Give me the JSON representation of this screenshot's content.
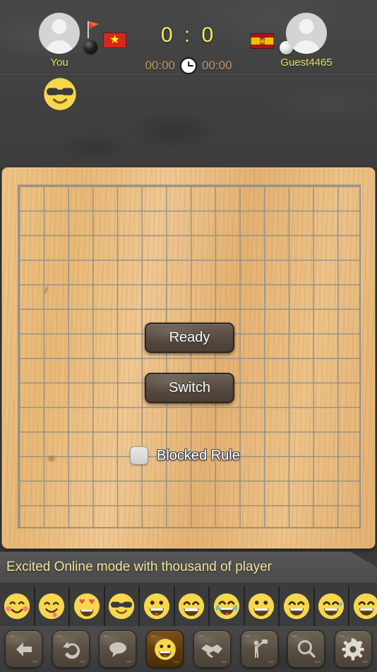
{
  "header": {
    "left_player": {
      "name": "You",
      "stone": "black-stone",
      "country_flag": "vietnam-flag",
      "turn_indicator": "red-pennant-flag",
      "avatar": "default-person-avatar"
    },
    "right_player": {
      "name": "Guest4465",
      "stone": "white-stone",
      "country_flag": "spain-flag",
      "avatar": "default-person-avatar"
    },
    "score": {
      "left": "0",
      "separator": ":",
      "right": "0",
      "display": "0 : 0",
      "color": "#f0ef5e"
    },
    "timers": {
      "left": "00:00",
      "right": "00:00",
      "clock_icon": "clock-icon",
      "color": "#c79a6a"
    },
    "chat_bubble_emoji": "sunglasses-face-emoji"
  },
  "board": {
    "type": "gomoku-board",
    "columns": 14,
    "rows": 14,
    "wood_color": "#e8b977",
    "grid_line_color": "#8f8f8a",
    "stones_placed": 0
  },
  "controls": {
    "blocked_rule": {
      "label": "Blocked Rule",
      "checked": false
    },
    "ready_label": "Ready",
    "switch_label": "Switch"
  },
  "ticker": {
    "text": "Excited Online mode with thousand of player",
    "color": "#f2e59a"
  },
  "emoji_strip": [
    {
      "name": "smiling-face-with-blush-emoji"
    },
    {
      "name": "face-savoring-food-emoji"
    },
    {
      "name": "smiling-face-with-heart-eyes-emoji"
    },
    {
      "name": "smiling-face-with-sunglasses-emoji"
    },
    {
      "name": "grinning-face-with-big-eyes-emoji"
    },
    {
      "name": "beaming-face-with-smiling-eyes-emoji"
    },
    {
      "name": "face-with-tears-of-joy-emoji"
    },
    {
      "name": "grinning-face-emoji"
    },
    {
      "name": "grinning-face-with-smiling-eyes-emoji"
    },
    {
      "name": "grinning-face-with-sweat-emoji"
    },
    {
      "name": "partial-emoji"
    }
  ],
  "toolbar": [
    {
      "name": "back-button",
      "icon": "back-arrow-icon",
      "active": false
    },
    {
      "name": "undo-button",
      "icon": "undo-arrow-icon",
      "active": false
    },
    {
      "name": "chat-button",
      "icon": "chat-bubble-icon",
      "active": false
    },
    {
      "name": "emoji-button",
      "icon": "smiley-face-icon",
      "active": true
    },
    {
      "name": "draw-button",
      "icon": "handshake-icon",
      "active": false
    },
    {
      "name": "resign-button",
      "icon": "person-flag-icon",
      "active": false
    },
    {
      "name": "search-button",
      "icon": "magnifier-icon",
      "active": false
    },
    {
      "name": "settings-button",
      "icon": "gear-icon",
      "active": false
    }
  ]
}
